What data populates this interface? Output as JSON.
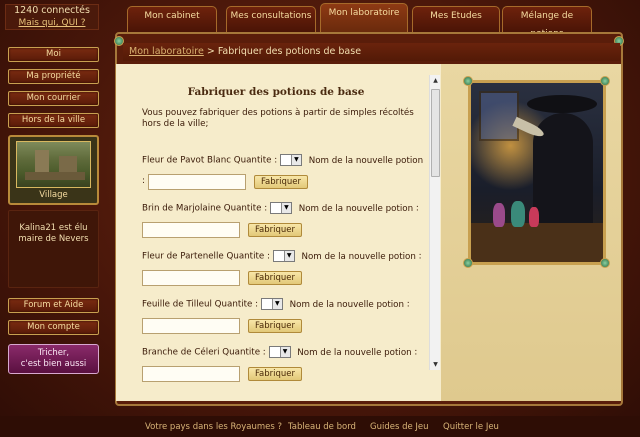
{
  "header": {
    "connected_count": "1240 connectés",
    "whoami_link": "Mais qui, QUI ?"
  },
  "tabs": [
    {
      "label": "Mon cabinet",
      "active": false
    },
    {
      "label": "Mes consultations",
      "active": false
    },
    {
      "label": "Mon laboratoire",
      "active": true
    },
    {
      "label": "Mes Etudes",
      "active": false
    },
    {
      "label": "Mélange de potions",
      "active": false
    }
  ],
  "sidebar": {
    "items": [
      {
        "label": "Moi"
      },
      {
        "label": "Ma propriété"
      },
      {
        "label": "Mon courrier"
      },
      {
        "label": "Hors de la ville"
      }
    ],
    "village_label": "Village",
    "news": "Kalina21 est élu maire de Nevers",
    "bottom_items": [
      {
        "label": "Forum et Aide"
      },
      {
        "label": "Mon compte"
      }
    ],
    "cheat_line1": "Tricher,",
    "cheat_line2": "c'est bien aussi"
  },
  "breadcrumb": {
    "link": "Mon laboratoire",
    "separator": ">",
    "current": "Fabriquer des potions de base"
  },
  "main": {
    "title": "Fabriquer des potions de base",
    "intro": "Vous pouvez fabriquer des potions à partir de simples récoltés hors de la ville;",
    "quantity_label": "Quantite :",
    "new_name_label": "Nom de la nouvelle potion",
    "colon": ":",
    "make_button": "Fabriquer",
    "ingredients": [
      {
        "name": "Fleur de Pavot Blanc"
      },
      {
        "name": "Brin de Marjolaine"
      },
      {
        "name": "Fleur de Partenelle"
      },
      {
        "name": "Feuille de Tilleul"
      },
      {
        "name": "Branche de Céleri"
      }
    ]
  },
  "footer": {
    "links": [
      {
        "label": "Votre pays dans les Royaumes ?"
      },
      {
        "label": "Tableau de bord"
      },
      {
        "label": "Guides de Jeu"
      },
      {
        "label": "Quitter le Jeu"
      }
    ]
  },
  "colors": {
    "background": "#4a170a",
    "content": "#f6eccb",
    "accent_gold": "#c8a050",
    "button": "#e8cc80"
  }
}
